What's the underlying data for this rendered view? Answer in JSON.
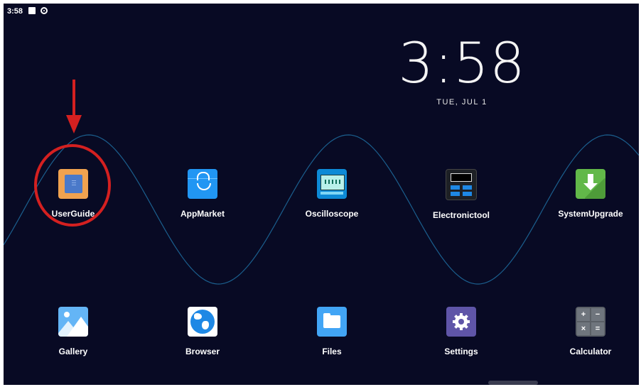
{
  "status_bar": {
    "time": "3:58",
    "icons": [
      "notification-square-icon",
      "sync-circle-icon"
    ]
  },
  "clock": {
    "time": "3:58",
    "date": "TUE, JUL 1"
  },
  "apps": [
    {
      "id": "userguide",
      "label": "UserGuide",
      "icon": "book-icon"
    },
    {
      "id": "appmarket",
      "label": "AppMarket",
      "icon": "shopping-bag-icon"
    },
    {
      "id": "oscilloscope",
      "label": "Oscilloscope",
      "icon": "oscilloscope-icon"
    },
    {
      "id": "electronictool",
      "label": "Electronictool",
      "icon": "calculator-device-icon"
    },
    {
      "id": "systemupgrade",
      "label": "SystemUpgrade",
      "icon": "download-arrow-icon"
    },
    {
      "id": "gallery",
      "label": "Gallery",
      "icon": "image-icon"
    },
    {
      "id": "browser",
      "label": "Browser",
      "icon": "globe-icon"
    },
    {
      "id": "files",
      "label": "Files",
      "icon": "folder-icon"
    },
    {
      "id": "settings",
      "label": "Settings",
      "icon": "gear-icon"
    },
    {
      "id": "calculator",
      "label": "Calculator",
      "icon": "calculator-icon"
    }
  ],
  "calculator_glyphs": [
    "+",
    "−",
    "×",
    "="
  ],
  "colors": {
    "background": "#080a24",
    "wave": "#1b5f8e",
    "annotation": "#d42020"
  }
}
